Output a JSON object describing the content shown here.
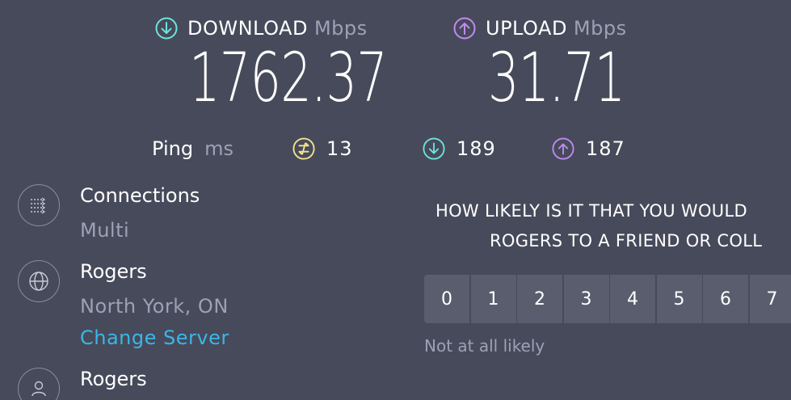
{
  "download": {
    "label": "DOWNLOAD",
    "unit": "Mbps",
    "value": "1762.37",
    "color": "#6de4dd"
  },
  "upload": {
    "label": "UPLOAD",
    "unit": "Mbps",
    "value": "31.71",
    "color": "#c08af2"
  },
  "ping": {
    "label": "Ping",
    "unit": "ms",
    "idle": "13",
    "download": "189",
    "upload": "187",
    "idle_color": "#f3e58f"
  },
  "connections": {
    "title": "Connections",
    "value": "Multi"
  },
  "server": {
    "title": "Rogers",
    "location": "North York, ON",
    "change_label": "Change Server"
  },
  "provider": {
    "title": "Rogers"
  },
  "survey": {
    "question_line1": "HOW LIKELY IS IT THAT YOU WOULD",
    "question_line2": "ROGERS TO A FRIEND OR COLL",
    "scale": [
      "0",
      "1",
      "2",
      "3",
      "4",
      "5",
      "6",
      "7"
    ],
    "low_hint": "Not at all likely"
  }
}
